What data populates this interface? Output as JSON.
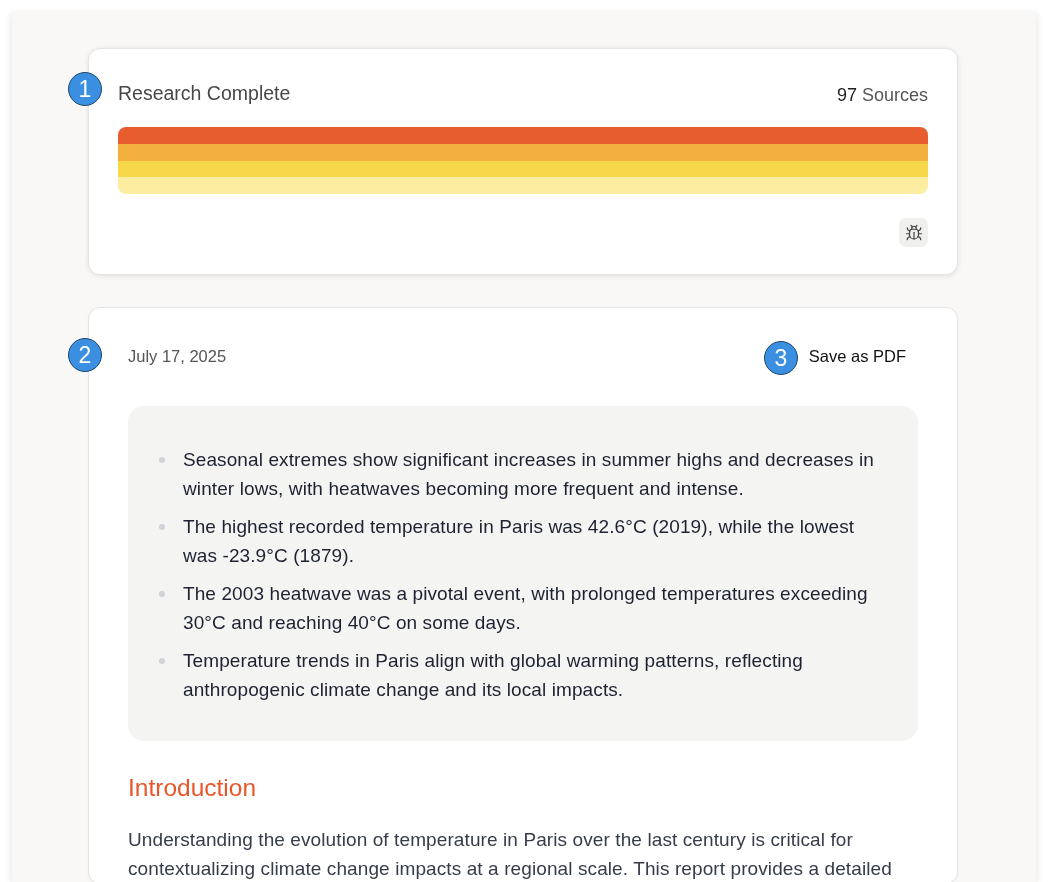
{
  "status_card": {
    "marker": "1",
    "title": "Research Complete",
    "sources_count": "97",
    "sources_label": "Sources"
  },
  "report_card": {
    "date_marker": "2",
    "date": "July 17, 2025",
    "save_button": {
      "marker": "3",
      "label": "Save as PDF"
    },
    "summary": [
      "Seasonal extremes show significant increases in summer highs and decreases in winter lows, with heatwaves becoming more frequent and intense.",
      "The highest recorded temperature in Paris was 42.6°C (2019), while the lowest was -23.9°C (1879).",
      "The 2003 heatwave was a pivotal event, with prolonged temperatures exceeding 30°C and reaching 40°C on some days.",
      "Temperature trends in Paris align with global warming patterns, reflecting anthropogenic climate change and its local impacts."
    ],
    "section_title": "Introduction",
    "paragraph": "Understanding the evolution of temperature in Paris over the last century is critical for contextualizing climate change impacts at a regional scale. This report provides a detailed"
  }
}
